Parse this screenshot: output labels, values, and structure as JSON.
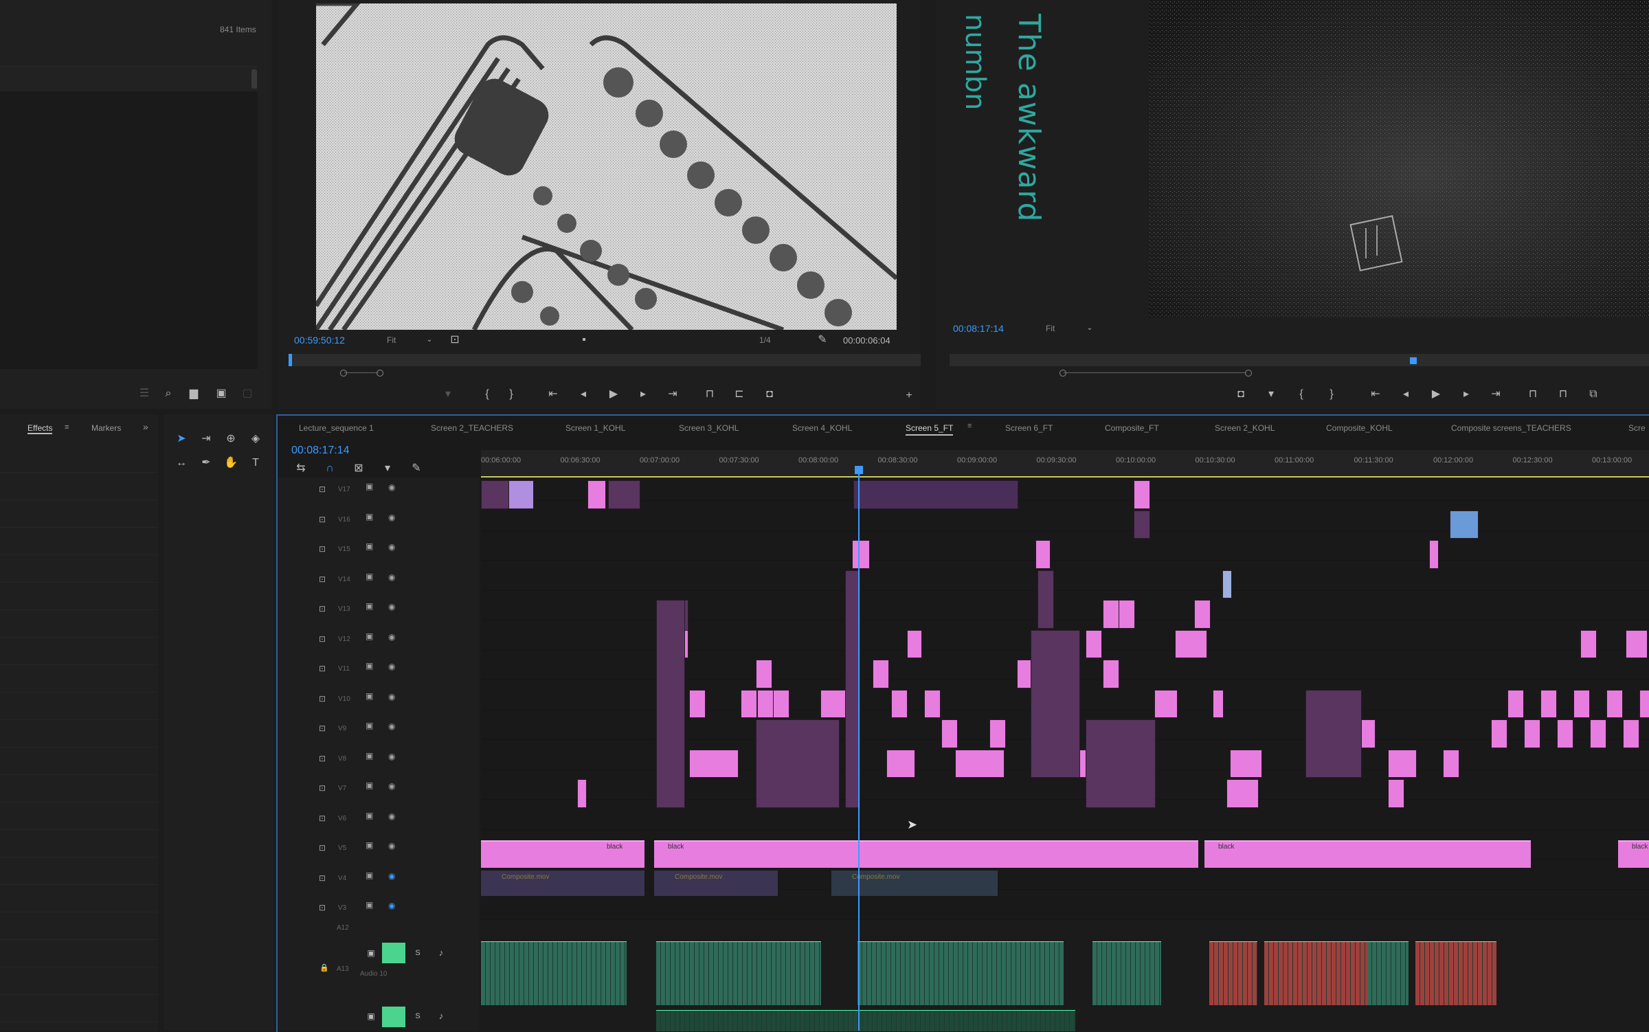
{
  "project": {
    "item_count": "841 Items"
  },
  "source_monitor": {
    "timecode": "00:59:50:12",
    "fit": "Fit",
    "resolution": "1/4",
    "duration": "00:00:06:04"
  },
  "program_monitor": {
    "timecode": "00:08:17:14",
    "fit": "Fit",
    "overlay_line1": "The awkward",
    "overlay_line2": "numbn"
  },
  "effects_panel": {
    "tabs": [
      "Effects",
      "Markers"
    ]
  },
  "timeline": {
    "timecode": "00:08:17:14",
    "sequence_tabs": [
      "Lecture_sequence 1",
      "Screen 2_TEACHERS",
      "Screen 1_KOHL",
      "Screen 3_KOHL",
      "Screen 4_KOHL",
      "Screen 5_FT",
      "Screen 6_FT",
      "Composite_FT",
      "Screen 2_KOHL",
      "Composite_KOHL",
      "Composite screens_TEACHERS",
      "Scre"
    ],
    "active_tab_index": 5,
    "ruler_labels": [
      "00:06:00:00",
      "00:06:30:00",
      "00:07:00:00",
      "00:07:30:00",
      "00:08:00:00",
      "00:08:30:00",
      "00:09:00:00",
      "00:09:30:00",
      "00:10:00:00",
      "00:10:30:00",
      "00:11:00:00",
      "00:11:30:00",
      "00:12:00:00",
      "00:12:30:00",
      "00:13:00:00"
    ],
    "video_tracks": [
      "V17",
      "V16",
      "V15",
      "V14",
      "V13",
      "V12",
      "V11",
      "V10",
      "V9",
      "V8",
      "V7",
      "V6",
      "V5",
      "V4",
      "V3"
    ],
    "audio_tracks": [
      "A12",
      "A13",
      "Audio 10"
    ],
    "clip_labels": {
      "black": "black",
      "ripple": "Composite.mov"
    }
  },
  "colors": {
    "timecode_blue": "#3a9bff",
    "clip_pink": "#e87de0",
    "clip_dark_purple": "#5a3560",
    "audio_green": "#2e6b58",
    "audio_red": "#a0403c",
    "highlight_green": "#4bd48e"
  }
}
